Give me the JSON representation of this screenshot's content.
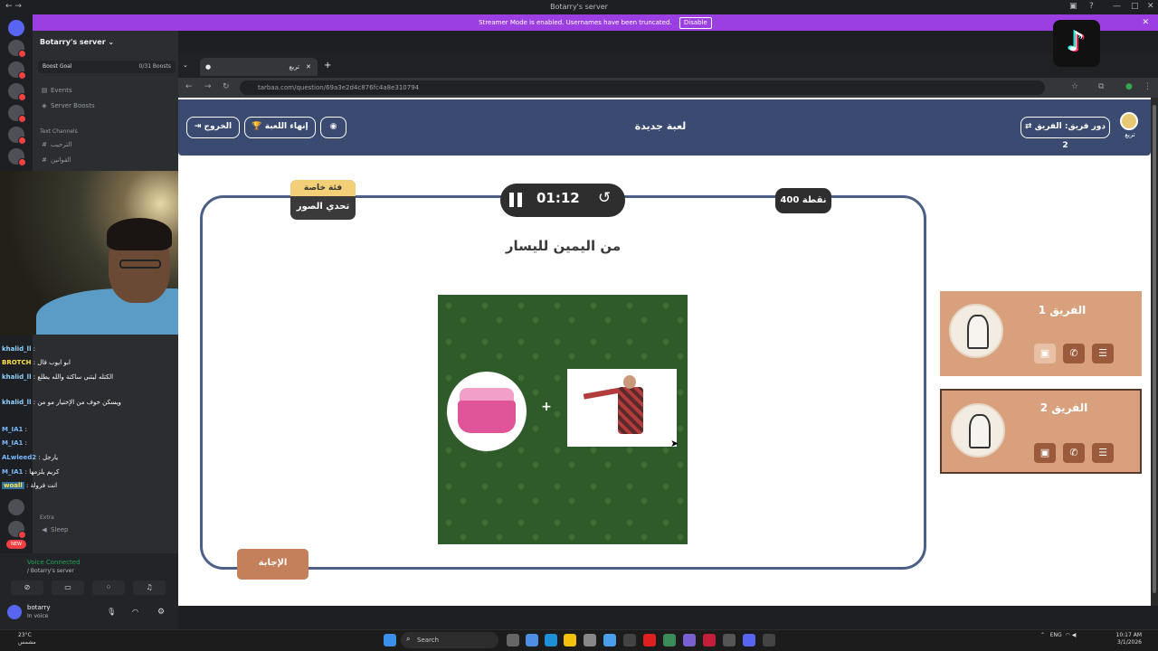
{
  "window": {
    "title": "Botarry's server",
    "banner_text": "Streamer Mode is enabled. Usernames have been truncated.",
    "banner_button": "Disable"
  },
  "discord": {
    "server_name": "Botarry's server",
    "boost_goal": "Boost Goal",
    "boost_count": "0/31 Boosts",
    "events": "Events",
    "server_boosts": "Server Boosts",
    "text_channels": "Text Channels",
    "channels": [
      "الترحيب",
      "القوانين"
    ],
    "extra": "Extra",
    "voice_channel": "Sleep",
    "voice_connected": "Voice Connected",
    "voice_server": "/ Botarry's server",
    "user_name": "botarry",
    "user_status": "In voice"
  },
  "chat": [
    {
      "user": "khalid_ll",
      "text": ":"
    },
    {
      "user": "BROTCH",
      "text": ": ابو ايوب قال"
    },
    {
      "user": "khalid_ll",
      "text": ": الكتله ليتني ساكتة والله يطلع"
    },
    {
      "user": "khalid_ll",
      "text": ": ويسكن خوف من الإختيار مو من"
    },
    {
      "user": "M_IA1",
      "text": ":"
    },
    {
      "user": "M_IA1",
      "text": ":"
    },
    {
      "user": "ALwleed2",
      "text": ": يارجل"
    },
    {
      "user": "M_IA1",
      "text": ": كريم يلزمها"
    },
    {
      "user": "woall",
      "text": ": انت فرولة"
    }
  ],
  "browser": {
    "tab_title": "تربع",
    "url": "tarbaa.com/question/69a3e2d4c876fc4a8e310794"
  },
  "game": {
    "header_title": "لعبة جديدة",
    "turn_label": "دور فريق: الفريق 2",
    "logo_text": "تربع",
    "exit_label": "الخروج",
    "end_game_label": "إنهاء اللعبة",
    "category_tag": "فئة خاصة",
    "category_name": "تحدي الصور",
    "timer": "01:12",
    "points": "400 نقطة",
    "question": "من اليمين لليسار",
    "plus": "+",
    "answer_label": "الإجابة",
    "teams": [
      {
        "name": "الفريق 1"
      },
      {
        "name": "الفريق 2"
      }
    ]
  },
  "taskbar": {
    "search_placeholder": "Search",
    "weather_temp": "23°C",
    "weather_desc": "مشمس",
    "lang": "ENG",
    "time": "10:17 AM",
    "date": "3/1/2026"
  },
  "colors": {
    "header_blue": "#3a4a70",
    "board_border": "#4c5f86",
    "team_card": "#d9a07d",
    "streamer_banner": "#9b3fe3"
  }
}
